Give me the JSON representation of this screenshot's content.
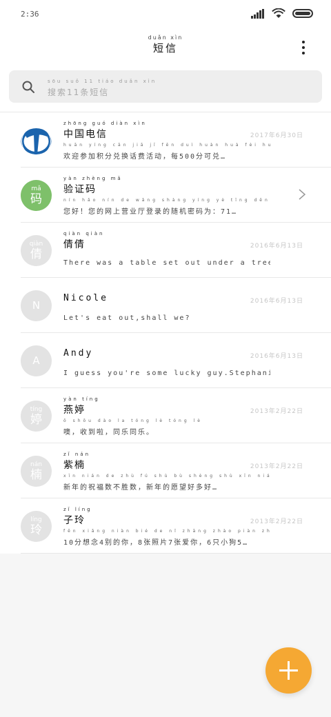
{
  "status": {
    "time": "2:36"
  },
  "header": {
    "title_pinyin": "duǎn xìn",
    "title": "短信"
  },
  "search": {
    "pinyin": "sōu suǒ 11 tiáo duǎn xìn",
    "placeholder": "搜索11条短信"
  },
  "conversations": [
    {
      "avatar_type": "logo",
      "avatar_pinyin": "",
      "avatar_text": "",
      "name_pinyin": "zhōng guó diàn xìn",
      "name": "中国电信",
      "date": "2017年6月30日",
      "preview_pinyin": "huān yíng cān jiā jī fēn duì huàn huà fèi huó dòng měi fēn kě duì",
      "preview": "欢迎参加积分兑换话费活动，每500分可兑…",
      "chevron": false
    },
    {
      "avatar_type": "green",
      "avatar_pinyin": "mǎ",
      "avatar_text": "码",
      "name_pinyin": "yàn zhèng mǎ",
      "name": "验证码",
      "date": "",
      "preview_pinyin": "nín hǎo nín de wǎng shàng yíng yè tīng dēng lù de suí jī mì mǎ wéi",
      "preview": "您好！您的网上营业厅登录的随机密码为：71…",
      "chevron": true
    },
    {
      "avatar_type": "char",
      "avatar_pinyin": "qiàn",
      "avatar_text": "倩",
      "name_pinyin": "qiàn qiàn",
      "name": "倩倩",
      "date": "2016年6月13日",
      "preview_pinyin": "",
      "preview": "There was a table set out under a tree in front …",
      "chevron": false
    },
    {
      "avatar_type": "letter",
      "avatar_pinyin": "",
      "avatar_text": "N",
      "name_pinyin": "",
      "name": "Nicole",
      "date": "2016年6月13日",
      "preview_pinyin": "",
      "preview": "Let's eat out,shall we?",
      "chevron": false
    },
    {
      "avatar_type": "letter",
      "avatar_pinyin": "",
      "avatar_text": "A",
      "name_pinyin": "",
      "name": "Andy",
      "date": "2016年6月13日",
      "preview_pinyin": "",
      "preview": "I guess you're some lucky guy.Stephanie is a nice…",
      "chevron": false
    },
    {
      "avatar_type": "char",
      "avatar_pinyin": "tíng",
      "avatar_text": "婷",
      "name_pinyin": "yàn tíng",
      "name": "燕婷",
      "date": "2013年2月22日",
      "preview_pinyin": "ō shōu dào la tóng lè tóng lè",
      "preview": "噢，收到啦，同乐同乐。",
      "chevron": false
    },
    {
      "avatar_type": "char",
      "avatar_pinyin": "nán",
      "avatar_text": "楠",
      "name_pinyin": "zǐ nán",
      "name": "紫楠",
      "date": "2013年2月22日",
      "preview_pinyin": "xīn nián de zhù fú shù bù shèng shù xīn nián de yuàn wàng duō duō",
      "preview": "新年的祝福数不胜数，新年的愿望好多好…",
      "chevron": false
    },
    {
      "avatar_type": "char",
      "avatar_pinyin": "líng",
      "avatar_text": "玲",
      "name_pinyin": "zǐ líng",
      "name": "子玲",
      "date": "2013年2月22日",
      "preview_pinyin": "fēn xiǎng niàn bié de nǐ zhāng zhào piàn zhāng ài nǐ zhī xiǎo gǒu",
      "preview": "10分想念4别的你，8张照片7张爱你，6只小狗5…",
      "chevron": false
    }
  ],
  "colors": {
    "accent": "#f5a833",
    "green_avatar": "#7ec06a",
    "grey_avatar": "#e3e3e3",
    "telecom_blue": "#1b64ad"
  },
  "icons": {
    "search": "search-icon",
    "more": "more-vertical-icon",
    "chevron": "chevron-right-icon",
    "add": "plus-icon"
  }
}
